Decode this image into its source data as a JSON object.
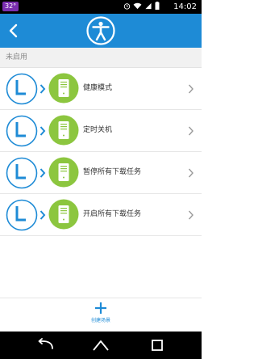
{
  "status_bar": {
    "badge": "32°",
    "time": "14:02",
    "icons": [
      "alarm-icon",
      "wifi-icon",
      "signal-icon",
      "battery-icon"
    ]
  },
  "app_bar": {
    "back_icon": "chevron-left-icon",
    "logo_icon": "person-accessibility-icon",
    "background": "#1e8bd6"
  },
  "section": {
    "title": "未启用"
  },
  "scenes": [
    {
      "label": "健康模式"
    },
    {
      "label": "定时关机"
    },
    {
      "label": "暂停所有下载任务"
    },
    {
      "label": "开启所有下载任务"
    }
  ],
  "create": {
    "label": "创建场景"
  },
  "colors": {
    "accent": "#1e8bd6",
    "device_green": "#8cc63f"
  }
}
